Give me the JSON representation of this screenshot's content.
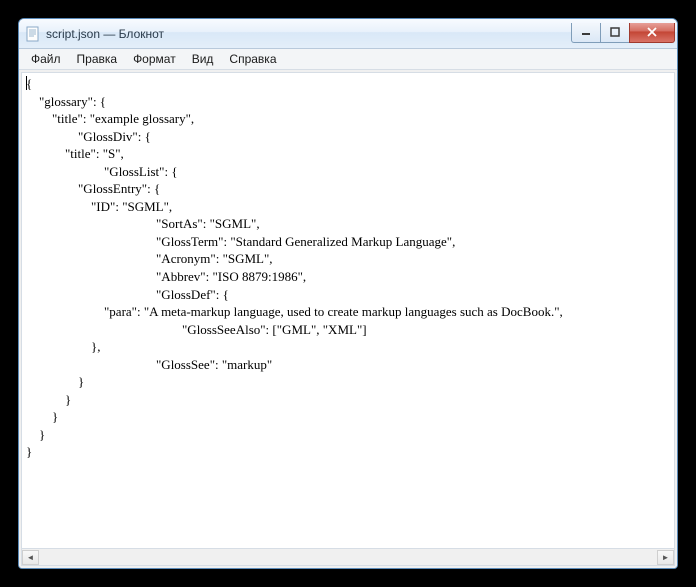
{
  "window": {
    "title": "script.json — Блокнот"
  },
  "menu": {
    "file": "Файл",
    "edit": "Правка",
    "format": "Формат",
    "view": "Вид",
    "help": "Справка"
  },
  "content": {
    "lines": [
      "{",
      "    \"glossary\": {",
      "        \"title\": \"example glossary\",",
      "\t\t\"GlossDiv\": {",
      "            \"title\": \"S\",",
      "\t\t\t\"GlossList\": {",
      "                \"GlossEntry\": {",
      "                    \"ID\": \"SGML\",",
      "\t\t\t\t\t\"SortAs\": \"SGML\",",
      "\t\t\t\t\t\"GlossTerm\": \"Standard Generalized Markup Language\",",
      "\t\t\t\t\t\"Acronym\": \"SGML\",",
      "\t\t\t\t\t\"Abbrev\": \"ISO 8879:1986\",",
      "\t\t\t\t\t\"GlossDef\": {",
      "                        \"para\": \"A meta-markup language, used to create markup languages such as DocBook.\",",
      "\t\t\t\t\t\t\"GlossSeeAlso\": [\"GML\", \"XML\"]",
      "                    },",
      "\t\t\t\t\t\"GlossSee\": \"markup\"",
      "                }",
      "            }",
      "        }",
      "    }",
      "}"
    ]
  }
}
